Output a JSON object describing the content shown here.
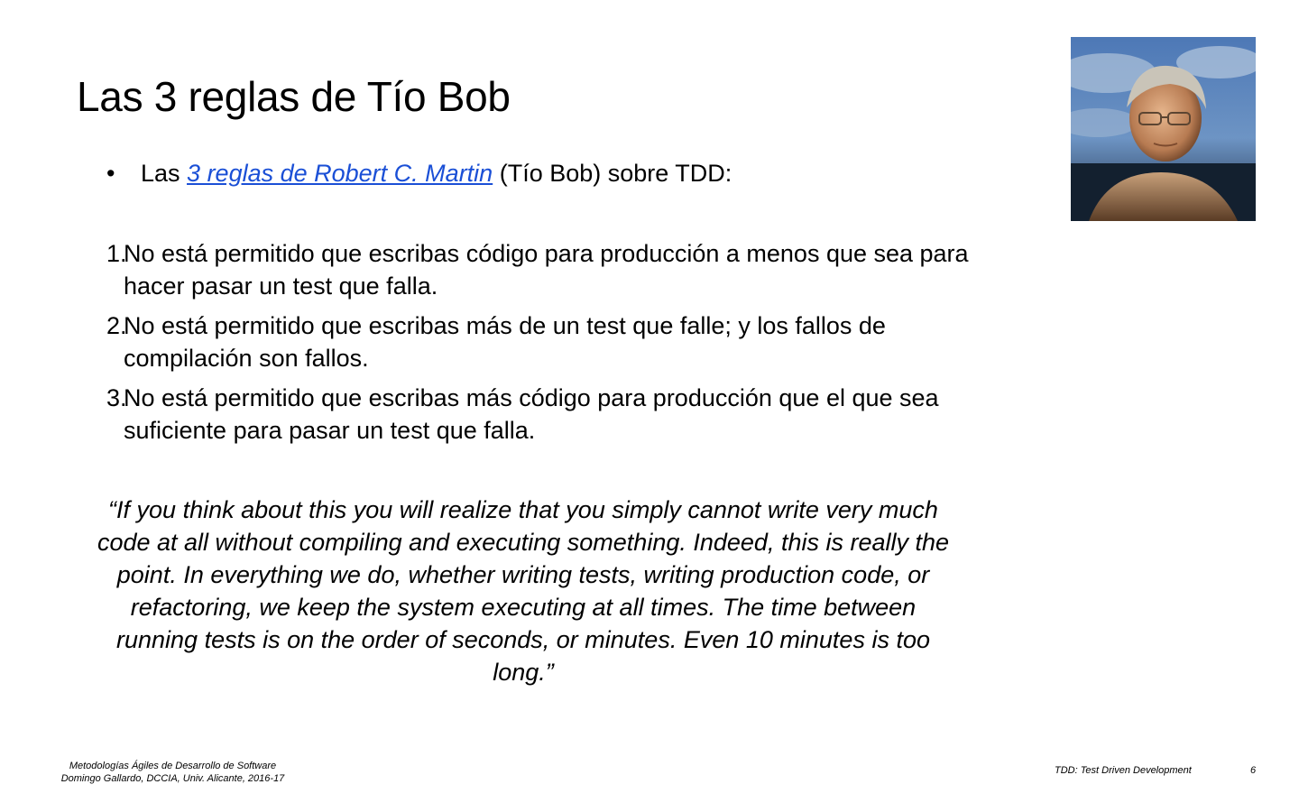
{
  "slide": {
    "title": "Las 3 reglas de Tío Bob",
    "bullet": {
      "marker": "•",
      "prefix": "Las ",
      "link_text": "3 reglas de Robert C. Martin",
      "suffix": " (Tío Bob) sobre TDD:"
    },
    "rules": [
      {
        "number": "1.",
        "text": "No está permitido que escribas código para producción a menos que sea para hacer pasar un test que falla."
      },
      {
        "number": "2.",
        "text": "No está permitido que escribas más de un test que falle; y los fallos de compilación son fallos."
      },
      {
        "number": "3.",
        "text": "No está permitido que escribas más código para producción que el que sea suficiente para pasar un test que falla."
      }
    ],
    "quote": "“If you think about this you will realize that you simply cannot write very much code at all without compiling and executing something. Indeed, this is really the point. In everything we do, whether writing tests, writing production code, or refactoring, we keep the system executing at all times. The time between running tests is on the order of seconds, or minutes. Even 10 minutes is too long.”",
    "photo_icon": "portrait-photo",
    "footer": {
      "course": "Metodologías Ágiles de Desarrollo de Software",
      "author": "Domingo Gallardo, DCCIA, Univ. Alicante, 2016-17",
      "topic": "TDD: Test Driven Development",
      "page": "6"
    },
    "colors": {
      "link": "#1a4fd6",
      "text": "#000000",
      "background": "#ffffff"
    }
  }
}
